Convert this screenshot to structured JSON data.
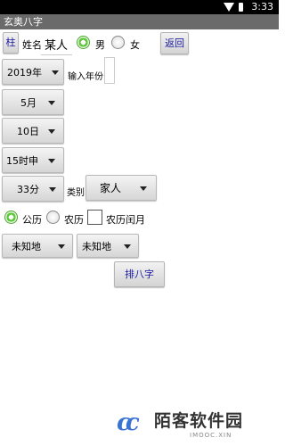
{
  "status_bar": {
    "time": "3:33"
  },
  "title_bar": {
    "title": "玄奥八字"
  },
  "form": {
    "pillar_button": "柱",
    "name_label": "姓名",
    "name_value": "某人",
    "gender": {
      "male": "男",
      "female": "女",
      "selected": "male"
    },
    "back_button": "返回",
    "year": "2019年",
    "year_input_label": "输入年份",
    "month": "5月",
    "day": "10日",
    "hour": "15时申",
    "minute": "33分",
    "category_label": "类别",
    "category": "家人",
    "calendar": {
      "solar": "公历",
      "lunar": "农历",
      "selected": "solar"
    },
    "leap_month_label": "农历闰月",
    "place1": "未知地",
    "place2": "未知地",
    "submit_button": "排八字"
  },
  "watermark": {
    "brand": "陌客软件园",
    "sub": "IMOOC.XIN",
    "mark": "cc"
  },
  "colors": {
    "title_bg": "#6a6a6a",
    "radio_on": "#5cc83a",
    "logo": "#3a74d2"
  }
}
